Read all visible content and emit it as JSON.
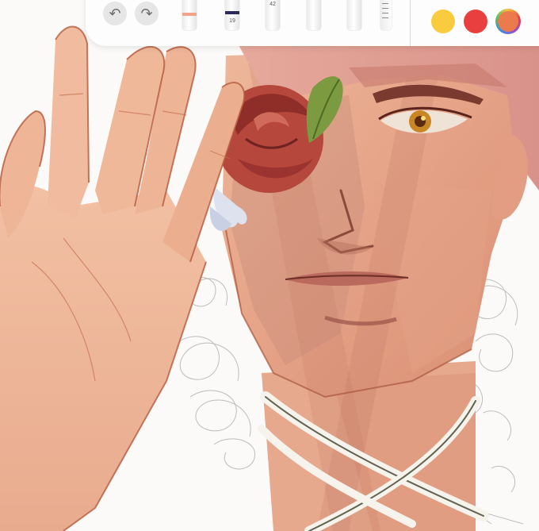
{
  "toolbar": {
    "undo_icon": "undo-icon",
    "redo_icon": "redo-icon",
    "tools": [
      {
        "name": "pen-tool",
        "band_color": "#f2a48a",
        "label": ""
      },
      {
        "name": "marker-tool",
        "band_color": "#2b2a58",
        "label": "19"
      },
      {
        "name": "pencil-tool",
        "band_color": "#f4c196",
        "label": "42"
      },
      {
        "name": "brush-tool",
        "band_color": "#f0a58e",
        "label": ""
      },
      {
        "name": "eraser-tool",
        "band_color": "#d8d8d8",
        "label": ""
      },
      {
        "name": "ruler-tool",
        "band_color": "#e4e4e4",
        "label": ""
      }
    ],
    "colors": [
      "#f9cc3f",
      "#e9403f",
      "#eb7a4c"
    ],
    "top_color_dots": [
      "#2b2b2b",
      "#2c62d1",
      "#59b957"
    ]
  }
}
